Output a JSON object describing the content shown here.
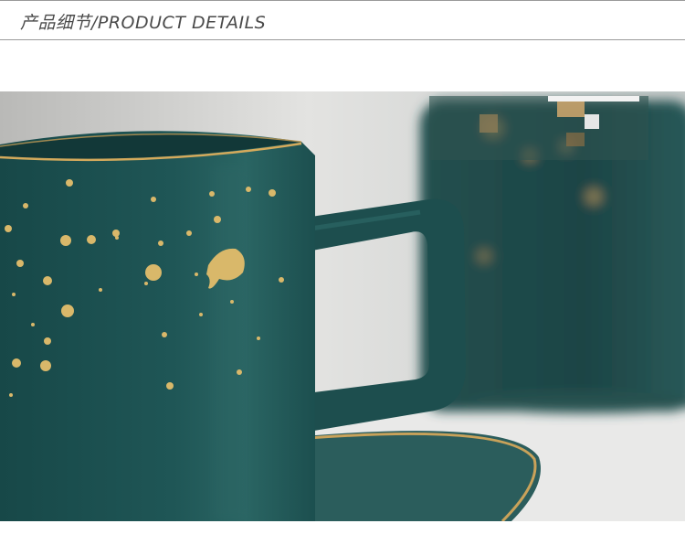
{
  "header": {
    "title": "产品细节/PRODUCT DETAILS"
  },
  "photo": {
    "subject": "mug-photo",
    "colors": {
      "mug": "#1f4f4f",
      "gold": "#d9b86a",
      "background": "#d6d6d6"
    }
  }
}
